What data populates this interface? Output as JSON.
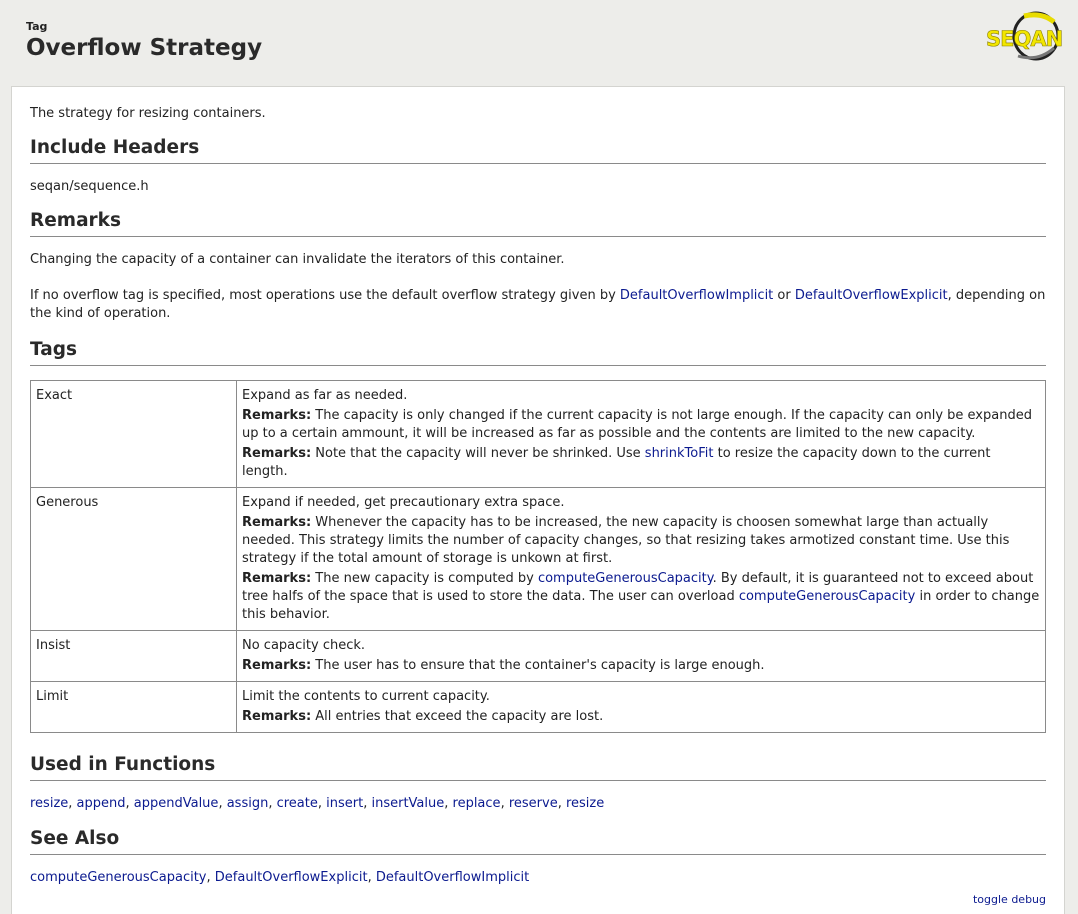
{
  "header": {
    "kind": "Tag",
    "title": "Overflow Strategy",
    "logo_text": "SEQAN"
  },
  "summary": "The strategy for resizing containers.",
  "include": {
    "heading": "Include Headers",
    "file": "seqan/sequence.h"
  },
  "remarks": {
    "heading": "Remarks",
    "p1": "Changing the capacity of a container can invalidate the iterators of this container.",
    "p2_before": "If no overflow tag is specified, most operations use the default overflow strategy given by ",
    "p2_link1": "DefaultOverflowImplicit",
    "p2_mid": " or ",
    "p2_link2": "DefaultOverflowExplicit",
    "p2_after": ", depending on the kind of operation."
  },
  "tags": {
    "heading": "Tags",
    "remarks_label": "Remarks:",
    "rows": [
      {
        "name": "Exact",
        "desc": "Expand as far as needed.",
        "r1": " The capacity is only changed if the current capacity is not large enough. If the capacity can only be expanded up to a certain ammount, it will be increased as far as possible and the contents are limited to the new capacity.",
        "r2_before": " Note that the capacity will never be shrinked. Use ",
        "r2_link": "shrinkToFit",
        "r2_after": " to resize the capacity down to the current length."
      },
      {
        "name": "Generous",
        "desc": "Expand if needed, get precautionary extra space.",
        "r1": " Whenever the capacity has to be increased, the new capacity is choosen somewhat large than actually needed. This strategy limits the number of capacity changes, so that resizing takes armotized constant time. Use this strategy if the total amount of storage is unkown at first.",
        "r2_before": " The new capacity is computed by ",
        "r2_link": "computeGenerousCapacity",
        "r2_mid": ". By default, it is guaranteed not to exceed about tree halfs of the space that is used to store the data. The user can overload ",
        "r2_link2": "computeGenerousCapacity",
        "r2_after": " in order to change this behavior."
      },
      {
        "name": "Insist",
        "desc": "No capacity check.",
        "r1": " The user has to ensure that the container's capacity is large enough."
      },
      {
        "name": "Limit",
        "desc": "Limit the contents to current capacity.",
        "r1": " All entries that exceed the capacity are lost."
      }
    ]
  },
  "functions": {
    "heading": "Used in Functions",
    "items": [
      "resize",
      "append",
      "appendValue",
      "assign",
      "create",
      "insert",
      "insertValue",
      "replace",
      "reserve",
      "resize"
    ]
  },
  "see_also": {
    "heading": "See Also",
    "items": [
      "computeGenerousCapacity",
      "DefaultOverflowExplicit",
      "DefaultOverflowImplicit"
    ]
  },
  "footer": {
    "toggle_debug": "toggle debug"
  },
  "colors": {
    "link": "#0b1a8f",
    "background": "#ededea",
    "logo_yellow": "#f2e600"
  }
}
